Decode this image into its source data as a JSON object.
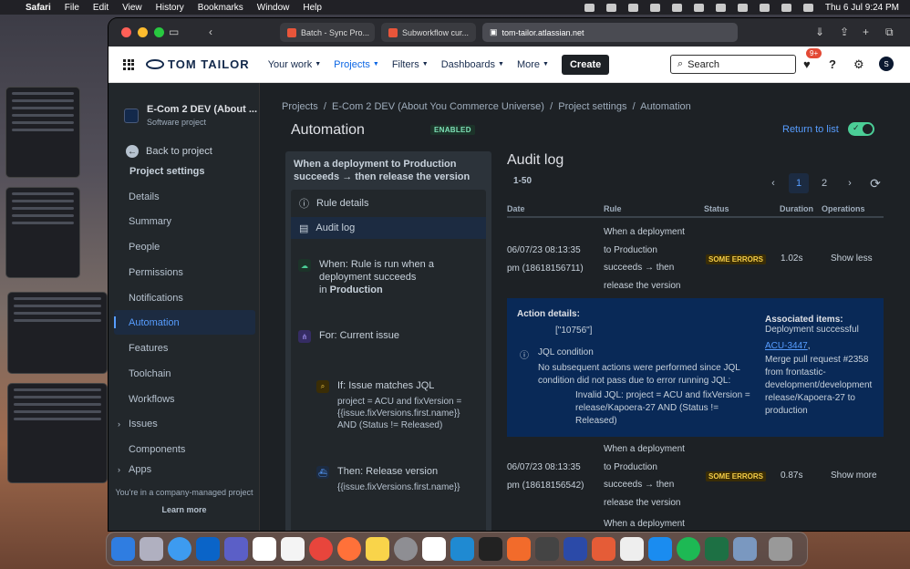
{
  "menubar": {
    "apple": "",
    "app": "Safari",
    "items": [
      "File",
      "Edit",
      "View",
      "History",
      "Bookmarks",
      "Window",
      "Help"
    ],
    "datetime": "Thu 6 Jul  9:24 PM"
  },
  "browser": {
    "tabs": [
      {
        "label": "Batch - Sync Pro..."
      },
      {
        "label": "Subworkflow cur..."
      }
    ],
    "address": "tom-tailor.atlassian.net"
  },
  "jira_nav": {
    "brand": "TOM TAILOR",
    "menu": [
      "Your work",
      "Projects",
      "Filters",
      "Dashboards",
      "More"
    ],
    "create": "Create",
    "search_placeholder": "Search",
    "notif_badge": "9+",
    "avatar_initial": "S"
  },
  "sidebar": {
    "project_name": "E-Com 2 DEV (About ...",
    "project_type": "Software project",
    "back": "Back to project",
    "section_title": "Project settings",
    "items": [
      "Details",
      "Summary",
      "People",
      "Permissions",
      "Notifications",
      "Automation",
      "Features",
      "Toolchain",
      "Workflows",
      "Issues",
      "Components",
      "Apps"
    ],
    "active": "Automation",
    "footer": "You're in a company-managed project",
    "learn_more": "Learn more"
  },
  "breadcrumb": [
    "Projects",
    "E-Com 2 DEV (About You Commerce Universe)",
    "Project settings",
    "Automation"
  ],
  "page": {
    "title": "Automation",
    "status": "ENABLED",
    "return_link": "Return to list",
    "toggle_mark": "✓"
  },
  "rule": {
    "title": "When a deployment to Production succeeds → then release the version",
    "menu": [
      "Rule details",
      "Audit log"
    ],
    "steps": [
      {
        "title": "When: Rule is run when a deployment succeeds",
        "title_suffix_prefix": "in ",
        "title_suffix_bold": "Production",
        "icon": "deployment-icon"
      },
      {
        "title": "For: Current issue",
        "icon": "branch-icon"
      },
      {
        "title": "If: Issue matches JQL",
        "detail": "project = ACU and fixVersion = {{issue.fixVersions.first.name}} AND (Status != Released)",
        "icon": "search-condition-icon"
      },
      {
        "title": "Then: Release version",
        "detail": "{{issue.fixVersions.first.name}}",
        "icon": "release-icon"
      }
    ]
  },
  "audit": {
    "title": "Audit log",
    "range": "1-50",
    "pages": [
      "1",
      "2"
    ],
    "columns": [
      "Date",
      "Rule",
      "Status",
      "Duration",
      "Operations"
    ],
    "rows": [
      {
        "date": "06/07/23 08:13:35 pm (18618156711)",
        "rule": [
          "When a deployment",
          "to Production",
          "succeeds → then",
          "release the version"
        ],
        "status": "SOME ERRORS",
        "duration": "1.02s",
        "op": "Show less"
      },
      {
        "date": "06/07/23 08:13:35 pm (18618156542)",
        "rule": [
          "When a deployment",
          "to Production",
          "succeeds → then",
          "release the version"
        ],
        "status": "SOME ERRORS",
        "duration": "0.87s",
        "op": "Show more"
      },
      {
        "rule": [
          "When a deployment"
        ]
      }
    ],
    "details": {
      "action_label": "Action details:",
      "id_value": "[\"10756\"]",
      "jql_label": "JQL condition",
      "jql_message": "No subsequent actions were performed since JQL condition did not pass due to error running JQL:",
      "jql_invalid": "Invalid JQL: project = ACU and fixVersion = release/Kapoera-27 AND (Status != Released)",
      "assoc_label": "Associated items:",
      "assoc_title": "Deployment successful",
      "assoc_link": "ACU-3447",
      "assoc_comma": ",",
      "assoc_text": "Merge pull request #2358 from frontastic-development/development release/Kapoera-27 to production"
    }
  }
}
